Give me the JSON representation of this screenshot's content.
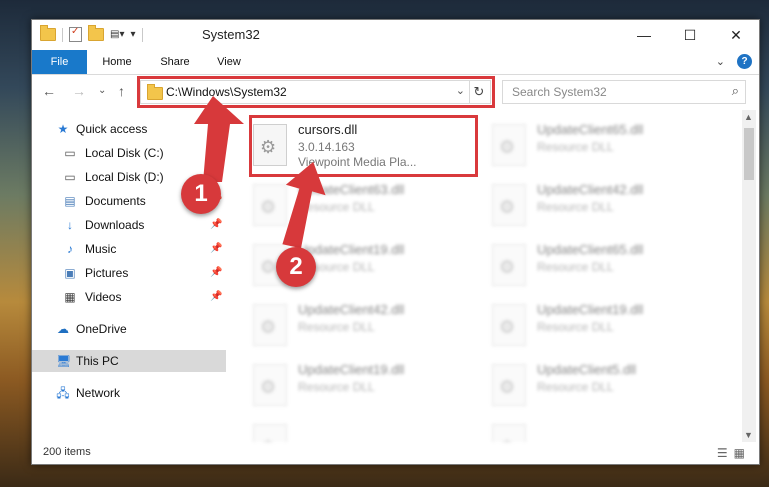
{
  "window": {
    "title": "System32",
    "minimize": "—",
    "maximize": "☐",
    "close": "✕"
  },
  "ribbon": {
    "tabs": [
      {
        "label": "File"
      },
      {
        "label": "Home"
      },
      {
        "label": "Share"
      },
      {
        "label": "View"
      }
    ],
    "expand": "⌄",
    "help": "?"
  },
  "nav": {
    "back": "←",
    "forward": "→",
    "recent": "⌄",
    "up": "↑",
    "address": "C:\\Windows\\System32",
    "address_drop": "⌄",
    "refresh": "↻",
    "search_placeholder": "Search System32",
    "search_icon": "⌕"
  },
  "sidebar": {
    "items": [
      {
        "label": "Quick access",
        "icon": "star-icon"
      },
      {
        "label": "Local Disk (C:)",
        "icon": "drive-icon"
      },
      {
        "label": "Local Disk (D:)",
        "icon": "drive-icon"
      },
      {
        "label": "Documents",
        "icon": "documents-icon"
      },
      {
        "label": "Downloads",
        "icon": "download-icon"
      },
      {
        "label": "Music",
        "icon": "music-icon"
      },
      {
        "label": "Pictures",
        "icon": "pictures-icon"
      },
      {
        "label": "Videos",
        "icon": "videos-icon"
      },
      {
        "label": "OneDrive",
        "icon": "cloud-icon"
      },
      {
        "label": "This PC",
        "icon": "pc-icon"
      },
      {
        "label": "Network",
        "icon": "network-icon"
      }
    ]
  },
  "files": [
    {
      "name": "cursors.dll",
      "line2": "3.0.14.163",
      "line3": "Viewpoint Media Pla..."
    },
    {
      "name": "UpdateClient65.dll",
      "line2": "Resource DLL"
    },
    {
      "name": "UpdateClient63.dll",
      "line2": "Resource DLL"
    },
    {
      "name": "UpdateClient42.dll",
      "line2": "Resource DLL"
    },
    {
      "name": "UpdateClient19.dll",
      "line2": "Resource DLL"
    },
    {
      "name": "UpdateClient65.dll",
      "line2": "Resource DLL"
    },
    {
      "name": "UpdateClient42.dll",
      "line2": "Resource DLL"
    },
    {
      "name": "UpdateClient19.dll",
      "line2": "Resource DLL"
    },
    {
      "name": "UpdateClient19.dll",
      "line2": "Resource DLL"
    },
    {
      "name": "UpdateClient5.dll",
      "line2": "Resource DLL"
    }
  ],
  "status": {
    "count": "200 items"
  },
  "annotations": {
    "step1": "1",
    "step2": "2"
  },
  "colors": {
    "accent": "#1979ca",
    "highlight": "#d9393c"
  }
}
